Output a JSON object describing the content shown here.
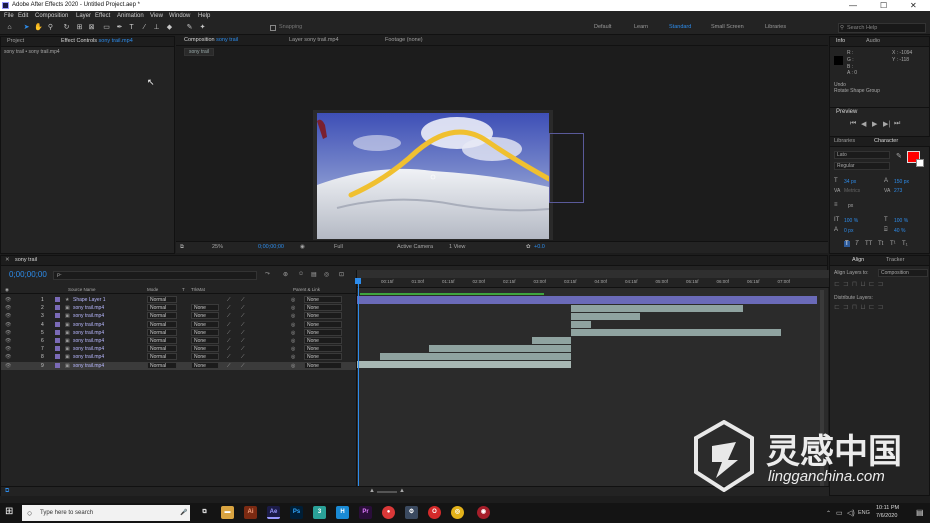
{
  "titlebar": {
    "title": "Adobe After Effects 2020 - Untitled Project.aep *",
    "controls": [
      "—",
      "☐",
      "✕"
    ]
  },
  "menu": [
    "File",
    "Edit",
    "Composition",
    "Layer",
    "Effect",
    "Animation",
    "View",
    "Window",
    "Help"
  ],
  "toolbar": {
    "snapping": "Snapping",
    "workspaces": [
      "Default",
      "Learn",
      "Standard",
      "Small Screen",
      "Libraries"
    ],
    "active_workspace": "Standard",
    "search_placeholder": "Search Help"
  },
  "project": {
    "tab": "Project",
    "effect_tab": "Effect Controls",
    "effect_target": "sony trail.mp4",
    "path": "sony trail • sony trail.mp4"
  },
  "comp": {
    "tab_comp": "Composition",
    "comp_name": "sony trail",
    "tab_layer": "Layer sony trail.mp4",
    "tab_footage": "Footage (none)",
    "sub_tab": "sony trail",
    "zoom": "25%",
    "timecode": "0;00;00;00",
    "resolution": "Full",
    "camera": "Active Camera",
    "views": "1 View",
    "exposure": "+0.0"
  },
  "info": {
    "tab_info": "Info",
    "tab_audio": "Audio",
    "r": "R :",
    "g": "G :",
    "b": "B :",
    "a": "A : 0",
    "x": "X : -1094",
    "y": "Y : -118",
    "undo": "Undo",
    "action": "Rotate Shape Group"
  },
  "preview": {
    "title": "Preview"
  },
  "character": {
    "tab_libraries": "Libraries",
    "tab_character": "Character",
    "font": "Lato",
    "style": "Regular",
    "size": "34 px",
    "leading": "150 px",
    "kerning": "Metrics",
    "tracking": "273",
    "stroke": "px",
    "vscale": "100 %",
    "hscale": "100 %",
    "baseline": "0 px",
    "tsume": "40 %",
    "fill_color": "#ff0000"
  },
  "timeline": {
    "comp_name": "sony trail",
    "timecode": "0;00;00;00",
    "search_placeholder": "ρ-",
    "headers": {
      "source": "Source Name",
      "mode": "Mode",
      "t": "T",
      "trkmat": "TrkMat",
      "parent": "Parent & Link"
    },
    "ruler": [
      "00:15f",
      "01:00f",
      "01:15f",
      "02:00f",
      "02:15f",
      "03:00f",
      "03:15f",
      "04:00f",
      "04:15f",
      "05:00f",
      "05:15f",
      "06:00f",
      "06:15f",
      "07:00f"
    ],
    "layers": [
      {
        "num": "1",
        "name": "Shape Layer 1",
        "mode": "Normal",
        "trk": "",
        "parent": "None"
      },
      {
        "num": "2",
        "name": "sony trail.mp4",
        "mode": "Normal",
        "trk": "None",
        "parent": "None"
      },
      {
        "num": "3",
        "name": "sony trail.mp4",
        "mode": "Normal",
        "trk": "None",
        "parent": "None"
      },
      {
        "num": "4",
        "name": "sony trail.mp4",
        "mode": "Normal",
        "trk": "None",
        "parent": "None"
      },
      {
        "num": "5",
        "name": "sony trail.mp4",
        "mode": "Normal",
        "trk": "None",
        "parent": "None"
      },
      {
        "num": "6",
        "name": "sony trail.mp4",
        "mode": "Normal",
        "trk": "None",
        "parent": "None"
      },
      {
        "num": "7",
        "name": "sony trail.mp4",
        "mode": "Normal",
        "trk": "None",
        "parent": "None"
      },
      {
        "num": "8",
        "name": "sony trail.mp4",
        "mode": "Normal",
        "trk": "None",
        "parent": "None"
      },
      {
        "num": "9",
        "name": "sony trail.mp4",
        "mode": "Normal",
        "trk": "None",
        "parent": "None"
      }
    ]
  },
  "align": {
    "tab_align": "Align",
    "tab_tracker": "Tracker",
    "align_to_label": "Align Layers to:",
    "align_to": "Composition",
    "distribute": "Distribute Layers:"
  },
  "taskbar": {
    "search_placeholder": "Type here to search",
    "time": "10:11 PM",
    "date": "7/6/2020",
    "lang": "ENG"
  },
  "watermark": {
    "cn": "灵感中国",
    "url": "lingganchina.com"
  }
}
